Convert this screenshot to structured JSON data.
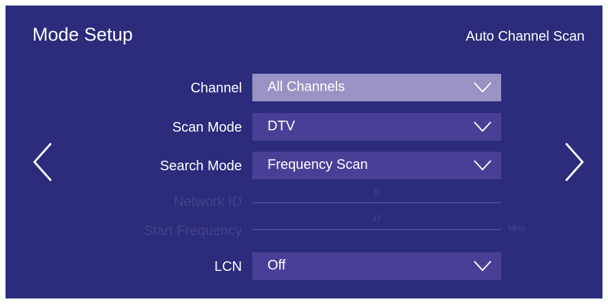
{
  "header": {
    "title": "Mode Setup",
    "subtitle": "Auto Channel Scan"
  },
  "rows": {
    "channel": {
      "label": "Channel",
      "value": "All Channels"
    },
    "scan_mode": {
      "label": "Scan Mode",
      "value": "DTV"
    },
    "search_mode": {
      "label": "Search Mode",
      "value": "Frequency Scan"
    },
    "network_id": {
      "label": "Network ID",
      "value": "0"
    },
    "start_frequency": {
      "label": "Start Frequency",
      "value": "47",
      "unit": "MHz"
    },
    "lcn": {
      "label": "LCN",
      "value": "Off"
    }
  },
  "icons": {
    "nav_left": "chevron-left-icon",
    "nav_right": "chevron-right-icon",
    "dropdown": "chevron-down-icon"
  },
  "colors": {
    "background": "#2c2b7c",
    "dropdown": "#4a3f97",
    "dropdown_focused": "#9a92c4",
    "disabled": "#44448a",
    "text": "#ffffff"
  }
}
